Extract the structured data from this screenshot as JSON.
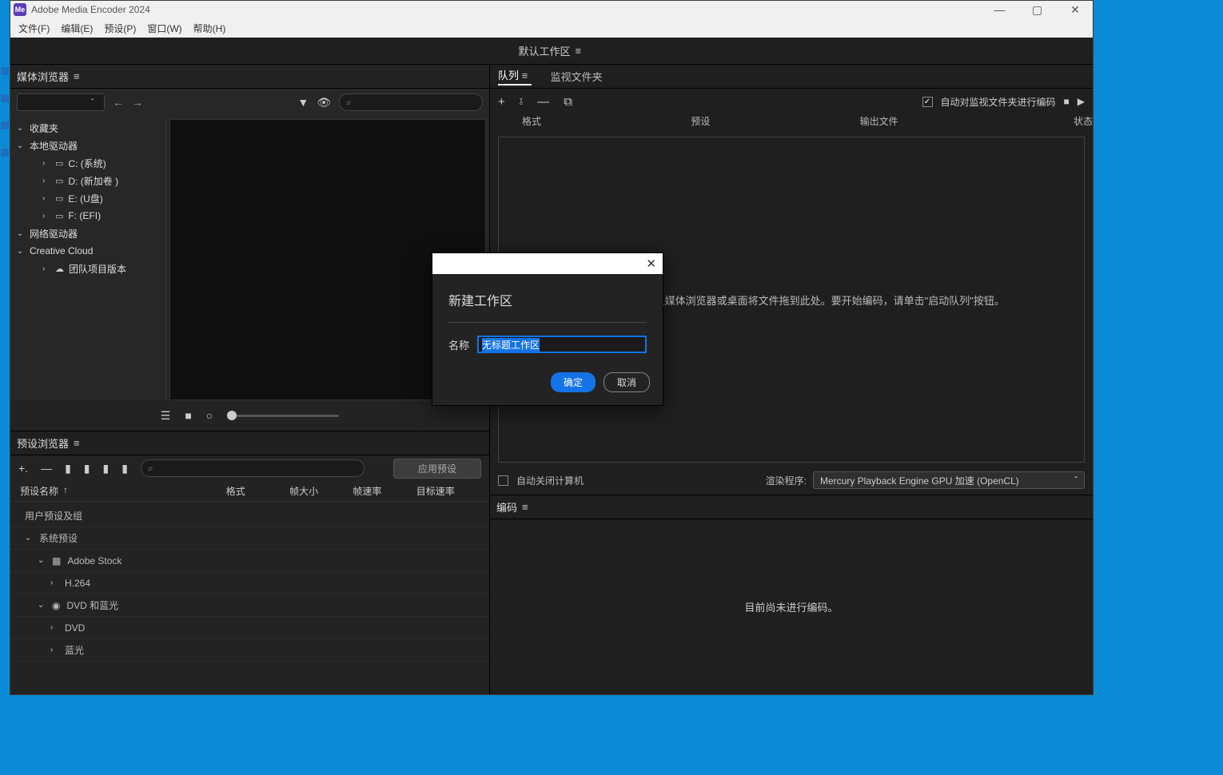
{
  "title": "Adobe Media Encoder 2024",
  "badge": "Me",
  "menus": {
    "file": "文件(F)",
    "edit": "编辑(E)",
    "preset": "预设(P)",
    "window": "窗口(W)",
    "help": "帮助(H)"
  },
  "workspace_bar": "默认工作区",
  "media_browser": {
    "title": "媒体浏览器",
    "favorites": "收藏夹",
    "local_drives": "本地驱动器",
    "drives": {
      "c": "C: (系统)",
      "d": "D: (新加卷 )",
      "e": "E: (U盘)",
      "f": "F: (EFI)"
    },
    "network": "网络驱动器",
    "cc": "Creative Cloud",
    "team": "团队项目版本"
  },
  "preset_browser": {
    "title": "预设浏览器",
    "apply": "应用预设",
    "cols": {
      "name": "预设名称",
      "format": "格式",
      "frame_size": "帧大小",
      "frame_rate": "帧速率",
      "target_rate": "目标速率"
    },
    "user": "用户预设及组",
    "system": "系统预设",
    "adobe_stock": "Adobe Stock",
    "h264": "H.264",
    "dvd": "DVD 和蓝光",
    "dvd_item": "DVD",
    "bluray": "蓝光"
  },
  "queue": {
    "tab_queue": "队列",
    "tab_watch": "监视文件夹",
    "auto_encode": "自动对监视文件夹进行编码",
    "cols": {
      "format": "格式",
      "preset": "预设",
      "output": "输出文件",
      "status": "状态"
    },
    "drop_msg": "添加源\"按钮或者从媒体浏览器或桌面将文件拖到此处。要开始编码，请单击\"启动队列\"按钮。",
    "auto_off": "自动关闭计算机",
    "renderer_label": "渲染程序:",
    "renderer_value": "Mercury Playback Engine GPU 加速 (OpenCL)"
  },
  "encode": {
    "title": "编码",
    "msg": "目前尚未进行编码。"
  },
  "dialog": {
    "title": "新建工作区",
    "label": "名称",
    "value": "无标题工作区",
    "ok": "确定",
    "cancel": "取消"
  }
}
